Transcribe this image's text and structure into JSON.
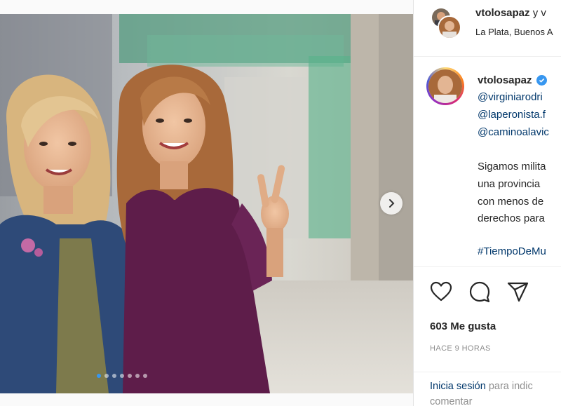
{
  "post": {
    "header": {
      "username": "vtolosapaz",
      "joiner": " y v",
      "location": "La Plata, Buenos A"
    },
    "caption": {
      "username": "vtolosapaz",
      "mentions": [
        "@virginiarodri",
        "@laperonista.f",
        "@caminoalavic"
      ],
      "text_lines": [
        "Sigamos milita",
        "una provincia",
        "con menos de",
        "derechos para"
      ],
      "hashtag": "#TiempoDeMu"
    },
    "likes": "603 Me gusta",
    "time_ago": "HACE 9 HORAS",
    "login_prompt": {
      "link": "Inicia sesión",
      "rest": " para indic",
      "line2": "comentar"
    },
    "carousel": {
      "total_slides": 7,
      "active_index": 0
    }
  },
  "icons": {
    "like": "heart-icon",
    "comment": "comment-icon",
    "share": "share-icon",
    "next": "chevron-right-icon",
    "verified": "verified-badge-icon"
  },
  "colors": {
    "link": "#00376b",
    "verified": "#3897f0",
    "muted": "#8e8e8e",
    "dot_active": "#3897f0"
  }
}
